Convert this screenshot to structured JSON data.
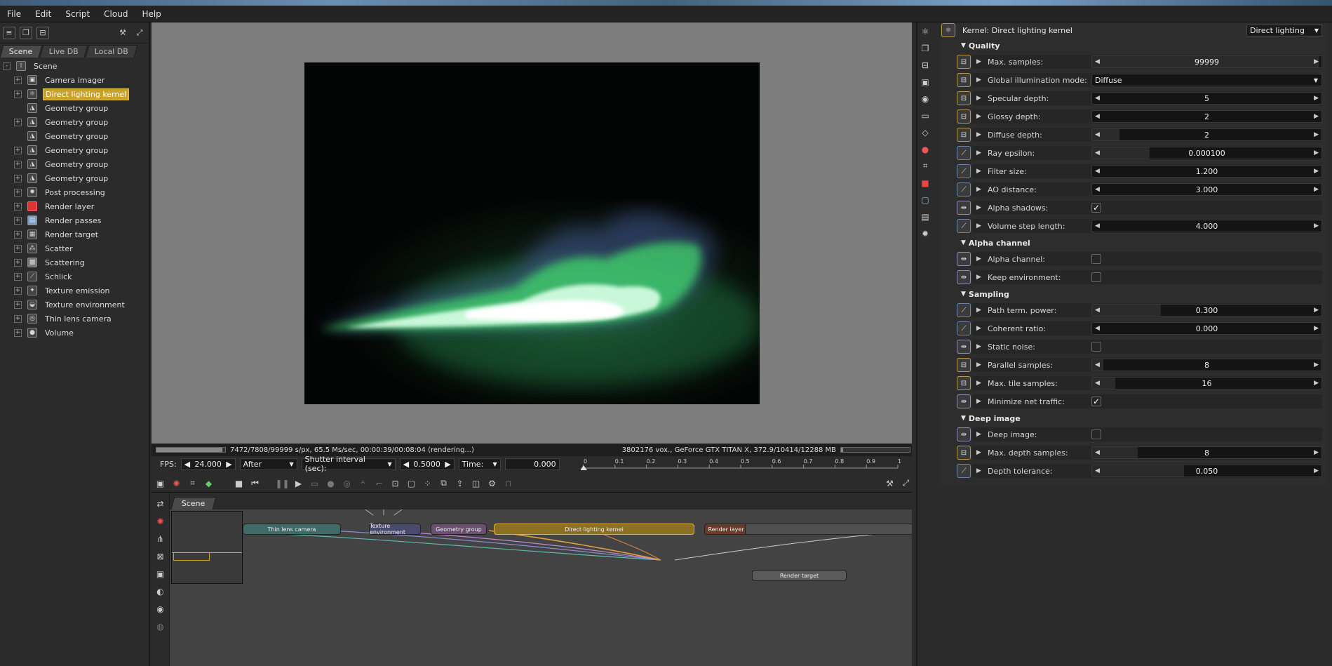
{
  "menu": [
    "File",
    "Edit",
    "Script",
    "Cloud",
    "Help"
  ],
  "left": {
    "tabs": [
      "Scene",
      "Live DB",
      "Local DB"
    ],
    "tree": [
      {
        "label": "Scene",
        "icon": "scene-icon",
        "expand": "-",
        "root": true
      },
      {
        "label": "Camera imager",
        "icon": "camera-imager-icon",
        "expand": "+"
      },
      {
        "label": "Direct lighting kernel",
        "icon": "kernel-icon",
        "expand": "+",
        "selected": true
      },
      {
        "label": "Geometry group",
        "icon": "geometry-icon",
        "expand": ""
      },
      {
        "label": "Geometry group",
        "icon": "geometry-icon",
        "expand": "+"
      },
      {
        "label": "Geometry group",
        "icon": "geometry-icon",
        "expand": ""
      },
      {
        "label": "Geometry group",
        "icon": "geometry-icon",
        "expand": "+"
      },
      {
        "label": "Geometry group",
        "icon": "geometry-icon",
        "expand": "+"
      },
      {
        "label": "Geometry group",
        "icon": "geometry-icon",
        "expand": "+"
      },
      {
        "label": "Post processing",
        "icon": "post-processing-icon",
        "expand": "+"
      },
      {
        "label": "Render layer",
        "icon": "render-layer-icon",
        "expand": "+"
      },
      {
        "label": "Render passes",
        "icon": "render-passes-icon",
        "expand": "+"
      },
      {
        "label": "Render target",
        "icon": "render-target-icon",
        "expand": "+"
      },
      {
        "label": "Scatter",
        "icon": "scatter-icon",
        "expand": "+"
      },
      {
        "label": "Scattering",
        "icon": "scattering-icon",
        "expand": "+"
      },
      {
        "label": "Schlick",
        "icon": "schlick-icon",
        "expand": "+"
      },
      {
        "label": "Texture emission",
        "icon": "texture-emission-icon",
        "expand": "+"
      },
      {
        "label": "Texture environment",
        "icon": "texture-environment-icon",
        "expand": "+"
      },
      {
        "label": "Thin lens camera",
        "icon": "thin-lens-camera-icon",
        "expand": "+"
      },
      {
        "label": "Volume",
        "icon": "volume-icon",
        "expand": "+"
      }
    ]
  },
  "status": {
    "left": "7472/7808/99999 s/px, 65.5 Ms/sec, 00:00:39/00:08:04 (rendering...)",
    "right": "3802176 vox., GeForce GTX TITAN X, 372.9/10414/12288 MB",
    "progress": 0.96
  },
  "controls": {
    "fps_label": "FPS:",
    "fps_value": "24.000",
    "after": "After",
    "shutter_label": "Shutter interval (sec):",
    "shutter_value": "0.5000",
    "time_label": "Time:",
    "time_value": "0.000",
    "ticks": [
      "0",
      "0.1",
      "0.2",
      "0.3",
      "0.4",
      "0.5",
      "0.6",
      "0.7",
      "0.8",
      "0.9",
      "1"
    ]
  },
  "nodegraph": {
    "tab": "Scene",
    "nodes": [
      {
        "label": "Thin lens camera",
        "color": "#3f6a68"
      },
      {
        "label": "Texture environment",
        "color": "#4a4a6e"
      },
      {
        "label": "Geometry group",
        "color": "#6a5070"
      },
      {
        "label": "Direct lighting kernel",
        "color": "#8a7020"
      },
      {
        "label": "Render layer",
        "color": "#6a3a2a"
      },
      {
        "label": "Render target",
        "color": "#5a5a5a"
      }
    ]
  },
  "kernel": {
    "title": "Kernel: Direct lighting kernel",
    "type": "Direct lighting",
    "sections": [
      {
        "title": "Quality",
        "params": [
          {
            "label": "Max. samples:",
            "kind": "int",
            "value": "99999",
            "fill": 0.99
          },
          {
            "label": "Global illumination mode:",
            "kind": "dropdown",
            "value": "Diffuse"
          },
          {
            "label": "Specular depth:",
            "kind": "int",
            "value": "5",
            "fill": 0.0
          },
          {
            "label": "Glossy depth:",
            "kind": "int",
            "value": "2",
            "fill": 0.0
          },
          {
            "label": "Diffuse depth:",
            "kind": "int",
            "value": "2",
            "fill": 0.12
          },
          {
            "label": "Ray epsilon:",
            "kind": "float",
            "value": "0.000100",
            "fill": 0.25
          },
          {
            "label": "Filter size:",
            "kind": "float",
            "value": "1.200",
            "fill": 0.0
          },
          {
            "label": "AO distance:",
            "kind": "float",
            "value": "3.000",
            "fill": 0.0
          },
          {
            "label": "Alpha shadows:",
            "kind": "bool",
            "value": true
          },
          {
            "label": "Volume step length:",
            "kind": "float",
            "value": "4.000",
            "fill": 0.0
          }
        ]
      },
      {
        "title": "Alpha channel",
        "params": [
          {
            "label": "Alpha channel:",
            "kind": "bool",
            "value": false
          },
          {
            "label": "Keep environment:",
            "kind": "bool",
            "value": false
          }
        ]
      },
      {
        "title": "Sampling",
        "params": [
          {
            "label": "Path term. power:",
            "kind": "float",
            "value": "0.300",
            "fill": 0.3
          },
          {
            "label": "Coherent ratio:",
            "kind": "float",
            "value": "0.000",
            "fill": 0.0
          },
          {
            "label": "Static noise:",
            "kind": "bool",
            "value": false
          },
          {
            "label": "Parallel samples:",
            "kind": "int",
            "value": "8",
            "fill": 0.05
          },
          {
            "label": "Max. tile samples:",
            "kind": "int",
            "value": "16",
            "fill": 0.1
          },
          {
            "label": "Minimize net traffic:",
            "kind": "bool",
            "value": true
          }
        ]
      },
      {
        "title": "Deep image",
        "params": [
          {
            "label": "Deep image:",
            "kind": "bool",
            "value": false
          },
          {
            "label": "Max. depth samples:",
            "kind": "int",
            "value": "8",
            "fill": 0.2
          },
          {
            "label": "Depth tolerance:",
            "kind": "float",
            "value": "0.050",
            "fill": 0.4
          }
        ]
      }
    ]
  },
  "colors": {
    "selection": "#c9a227",
    "int_param": "#b59a47",
    "float_param": "#6b86a6",
    "bool_param": "#9a88b5",
    "flame": "#7dff9a"
  }
}
